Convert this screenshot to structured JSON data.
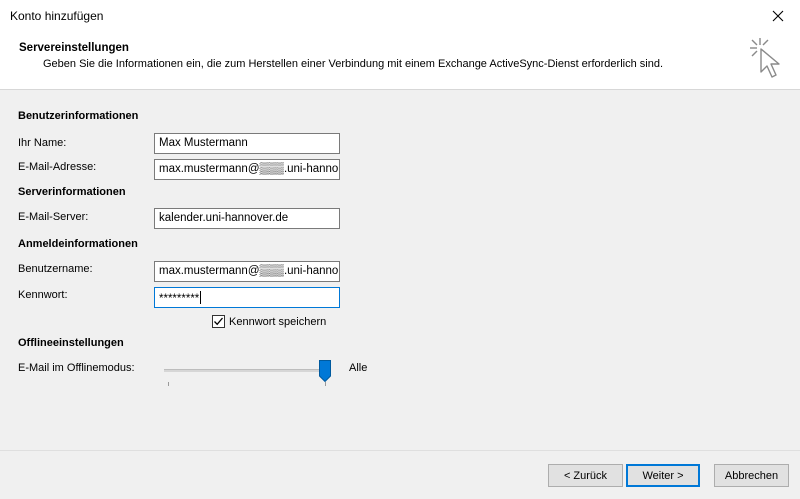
{
  "window": {
    "title": "Konto hinzufügen"
  },
  "header": {
    "title": "Servereinstellungen",
    "description": "Geben Sie die Informationen ein, die zum Herstellen einer Verbindung mit einem Exchange ActiveSync-Dienst erforderlich sind."
  },
  "user_info": {
    "section": "Benutzerinformationen",
    "name_label": "Ihr Name:",
    "name_value": "Max Mustermann",
    "email_label": "E-Mail-Adresse:",
    "email_value": "max.mustermann@▒▒▒.uni-hanno"
  },
  "server_info": {
    "section": "Serverinformationen",
    "server_label": "E-Mail-Server:",
    "server_value": "kalender.uni-hannover.de"
  },
  "login_info": {
    "section": "Anmeldeinformationen",
    "username_label": "Benutzername:",
    "username_value": "max.mustermann@▒▒▒.uni-hanno",
    "password_label": "Kennwort:",
    "password_value": "*********",
    "remember_label": "Kennwort speichern",
    "remember_checked": true
  },
  "offline": {
    "section": "Offlineeinstellungen",
    "mode_label": "E-Mail im Offlinemodus:",
    "slider_value": "Alle",
    "slider_level": 1.0
  },
  "buttons": {
    "back": "< Zurück",
    "next": "Weiter >",
    "cancel": "Abbrechen"
  },
  "icons": {
    "close": "close-icon",
    "wizard": "wizard-cursor-icon",
    "check": "checkmark-icon"
  },
  "colors": {
    "accent": "#0078d7",
    "panel": "#f0f0f0"
  }
}
